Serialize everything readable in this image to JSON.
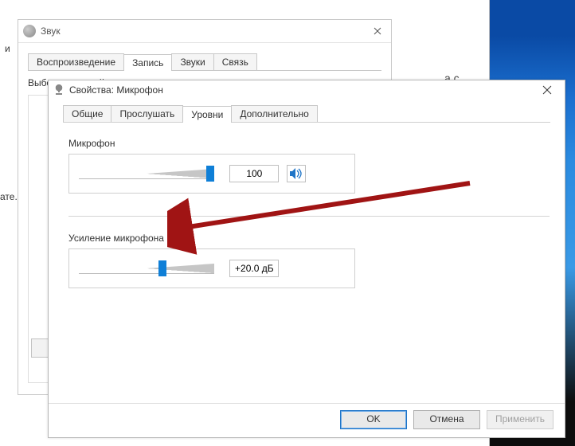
{
  "back_window": {
    "title": "Звук",
    "tabs": [
      "Воспроизведение",
      "Запись",
      "Звуки",
      "Связь"
    ],
    "active_tab_index": 1,
    "prompt": "Выберите устройство записи, параметры которого нужно изменить:"
  },
  "front_window": {
    "title": "Свойства: Микрофон",
    "tabs": [
      "Общие",
      "Прослушать",
      "Уровни",
      "Дополнительно"
    ],
    "active_tab_index": 2,
    "mic": {
      "label": "Микрофон",
      "value": "100",
      "slider_percent": 100
    },
    "boost": {
      "label": "Усиление микрофона",
      "value": "+20.0 дБ",
      "slider_percent": 62
    },
    "buttons": {
      "ok": "OK",
      "cancel": "Отмена",
      "apply": "Применить"
    }
  },
  "stray": {
    "s1": "а с",
    "left1": "и",
    "left2": "ате."
  }
}
